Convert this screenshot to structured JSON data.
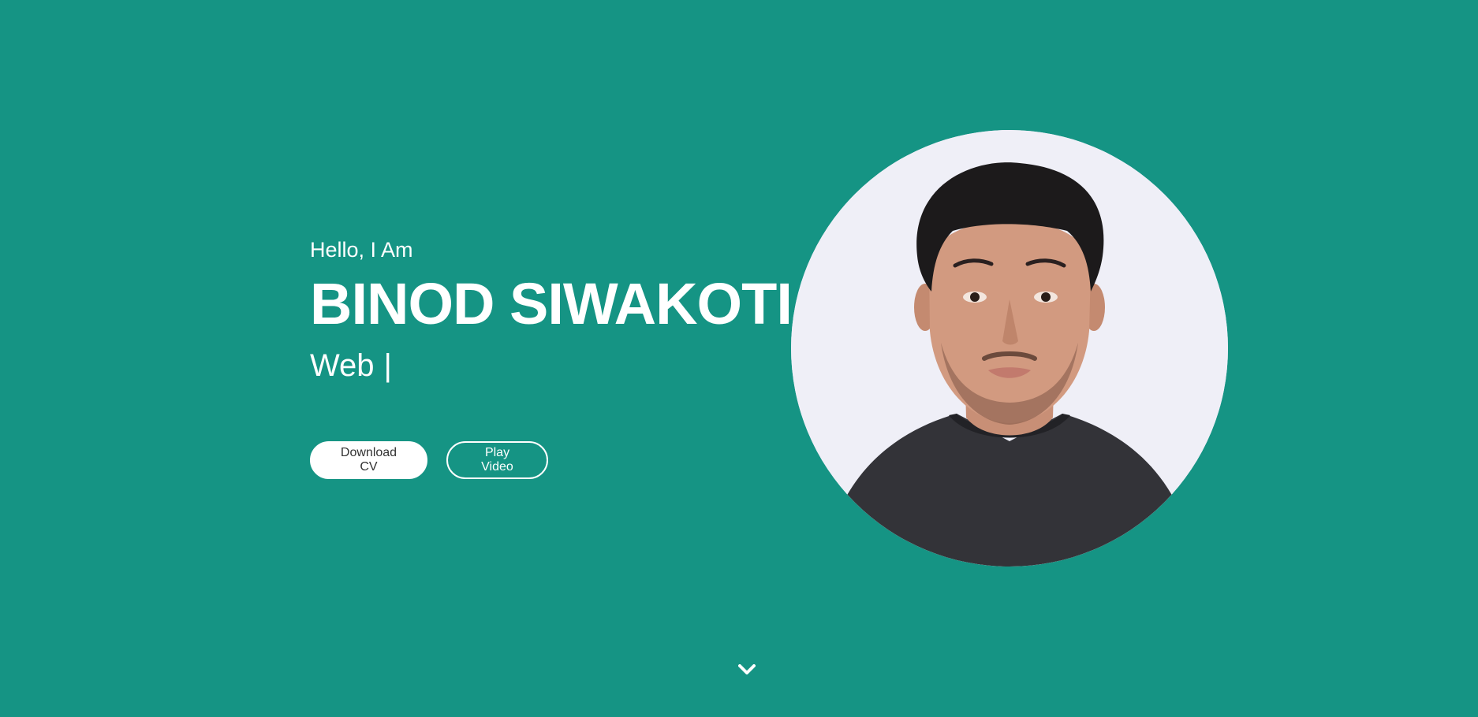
{
  "hero": {
    "greeting": "Hello, I Am",
    "name": "BINOD SIWAKOTI",
    "role": "Web",
    "cursor": "|",
    "buttons": {
      "download_cv": "Download CV",
      "play_video": "Play Video"
    }
  },
  "icons": {
    "scroll_down": "chevron-down-icon"
  },
  "colors": {
    "background": "#159484",
    "text": "#ffffff",
    "button_solid_text": "#333333"
  }
}
